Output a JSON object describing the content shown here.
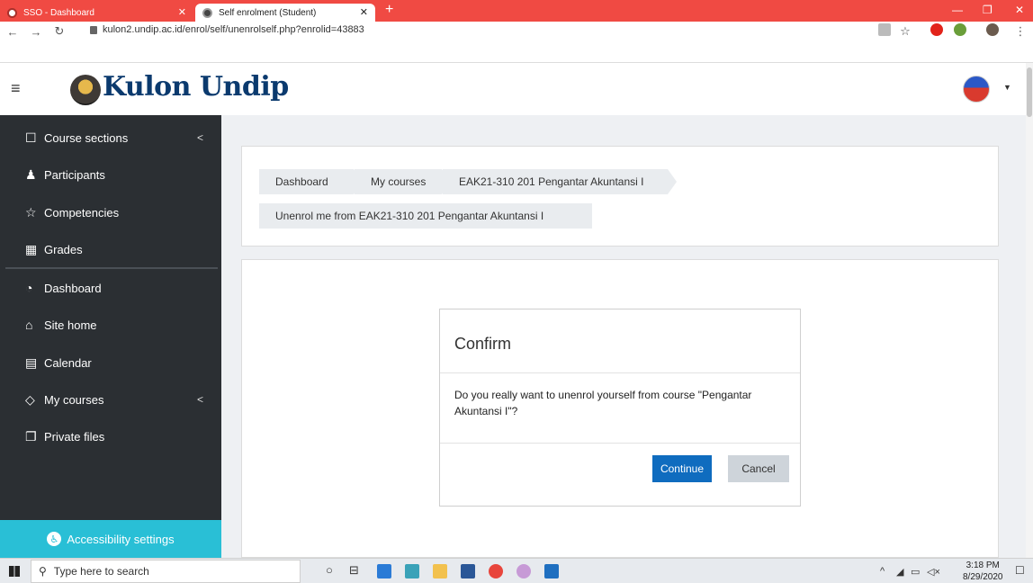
{
  "browser": {
    "tabs": [
      {
        "title": "SSO - Dashboard",
        "active": false
      },
      {
        "title": "Self enrolment (Student)",
        "active": true
      }
    ],
    "new_tab_symbol": "+",
    "url": "kulon2.undip.ac.id/enrol/self/unenrolself.php?enrolid=43883",
    "window_controls": [
      "—",
      "❐",
      "✕"
    ]
  },
  "header": {
    "site_name": "Kulon Undip"
  },
  "sidebar": {
    "items": [
      {
        "label": "Course sections",
        "icon": "folder-icon",
        "has_chevron": true
      },
      {
        "label": "Participants",
        "icon": "users-icon",
        "has_chevron": false
      },
      {
        "label": "Competencies",
        "icon": "star-icon",
        "has_chevron": false
      },
      {
        "label": "Grades",
        "icon": "table-icon",
        "has_chevron": false
      },
      {
        "label": "Dashboard",
        "icon": "gauge-icon",
        "has_chevron": false
      },
      {
        "label": "Site home",
        "icon": "home-icon",
        "has_chevron": false
      },
      {
        "label": "Calendar",
        "icon": "calendar-icon",
        "has_chevron": false
      },
      {
        "label": "My courses",
        "icon": "graduation-cap-icon",
        "has_chevron": true
      },
      {
        "label": "Private files",
        "icon": "files-icon",
        "has_chevron": false
      }
    ],
    "accessibility_label": "Accessibility settings"
  },
  "breadcrumb": [
    "Dashboard",
    "My courses",
    "EAK21-310 201 Pengantar Akuntansi I",
    "Unenrol me from EAK21-310 201 Pengantar Akuntansi I"
  ],
  "dialog": {
    "title": "Confirm",
    "message": "Do you really want to unenrol yourself from course \"Pengantar Akuntansi I\"?",
    "continue_label": "Continue",
    "cancel_label": "Cancel"
  },
  "taskbar": {
    "search_placeholder": "Type here to search",
    "time": "3:18 PM",
    "date": "8/29/2020"
  },
  "colors": {
    "tab_bar": "#f04a43",
    "sidebar": "#2b2f33",
    "accessibility": "#29bfd6",
    "primary_button": "#0f6cbf",
    "brand": "#0b3a6e"
  }
}
